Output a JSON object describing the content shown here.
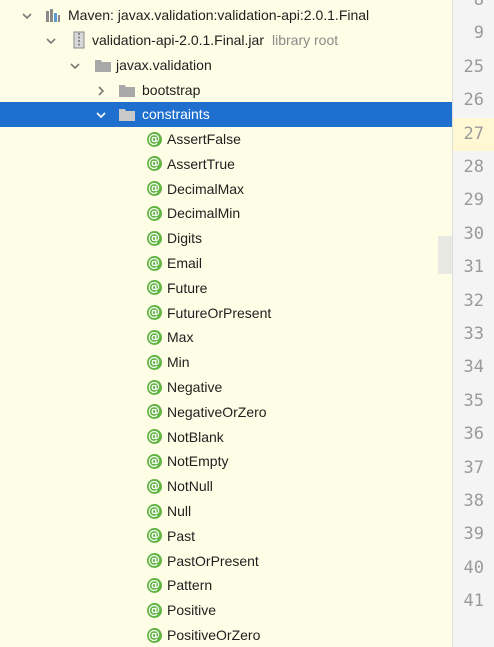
{
  "tree": {
    "maven_root": {
      "label": "Maven: javax.validation:validation-api:2.0.1.Final",
      "icon": "library-icon"
    },
    "jar": {
      "label": "validation-api-2.0.1.Final.jar",
      "hint": "library root",
      "icon": "jar-icon"
    },
    "package_root": {
      "label": "javax.validation",
      "icon": "package-icon"
    },
    "bootstrap": {
      "label": "bootstrap",
      "icon": "package-icon"
    },
    "constraints": {
      "label": "constraints",
      "icon": "package-icon",
      "selected": true
    },
    "annotations": [
      "AssertFalse",
      "AssertTrue",
      "DecimalMax",
      "DecimalMin",
      "Digits",
      "Email",
      "Future",
      "FutureOrPresent",
      "Max",
      "Min",
      "Negative",
      "NegativeOrZero",
      "NotBlank",
      "NotEmpty",
      "NotNull",
      "Null",
      "Past",
      "PastOrPresent",
      "Pattern",
      "Positive",
      "PositiveOrZero"
    ],
    "annotation_glyph": "@"
  },
  "gutter": {
    "line_numbers": [
      "8",
      "9",
      "25",
      "26",
      "27",
      "28",
      "29",
      "30",
      "31",
      "32",
      "33",
      "34",
      "35",
      "36",
      "37",
      "38",
      "39",
      "40",
      "41"
    ],
    "current_line": "27"
  },
  "colors": {
    "tree_background": "#fefde6",
    "selection": "#1f6fcf",
    "annotation_badge": "#62b543",
    "folder": "#a8a8a8"
  }
}
